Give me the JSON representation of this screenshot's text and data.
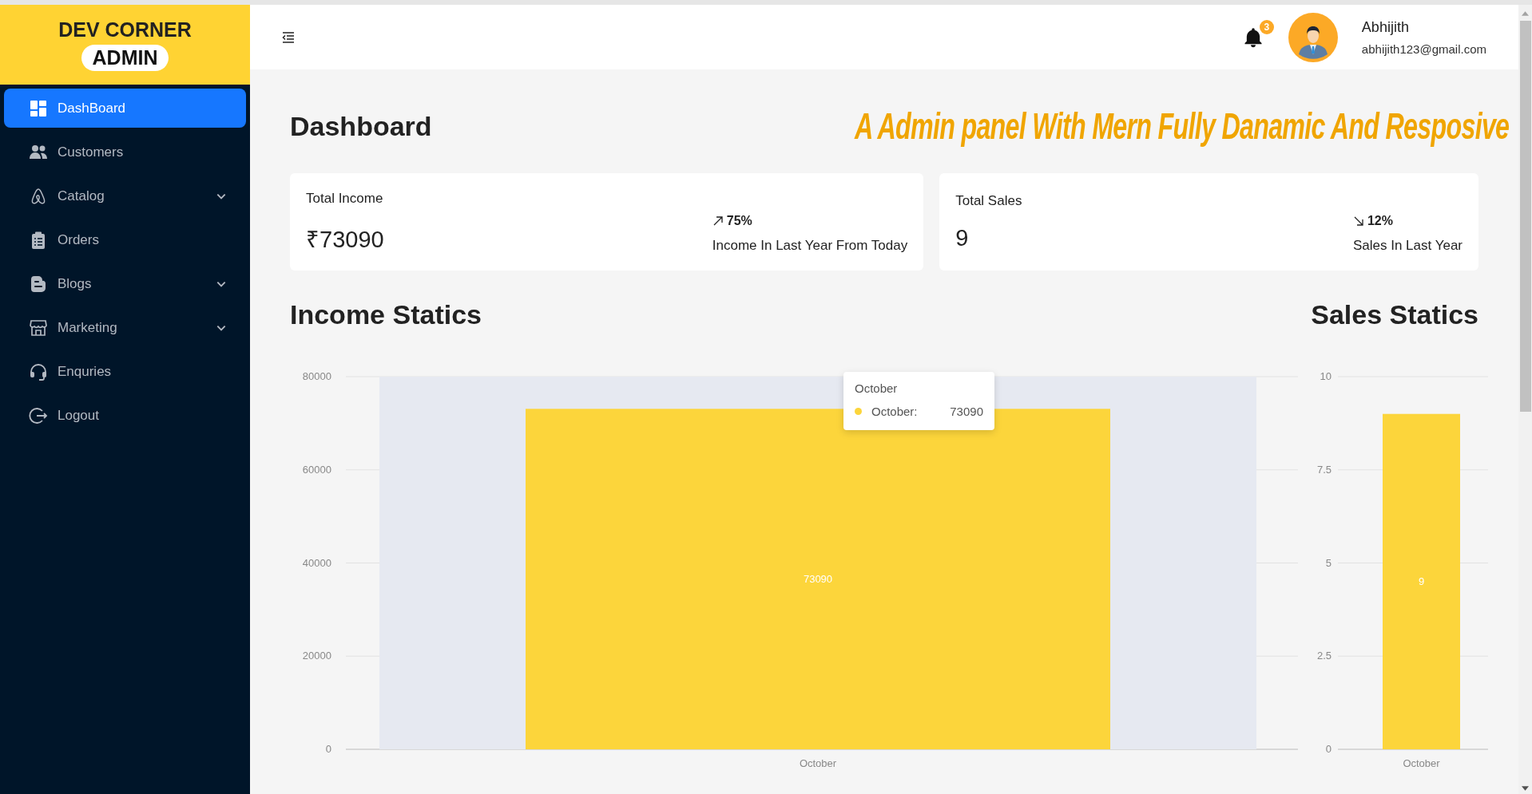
{
  "sidebar": {
    "brand": "DEV CORNER",
    "brand_badge": "ADMIN",
    "items": [
      {
        "label": "DashBoard",
        "kind": "dashboard",
        "selected": true,
        "has_submenu": false
      },
      {
        "label": "Customers",
        "kind": "users",
        "selected": false,
        "has_submenu": false
      },
      {
        "label": "Catalog",
        "kind": "catalog",
        "selected": false,
        "has_submenu": true
      },
      {
        "label": "Orders",
        "kind": "clipboard",
        "selected": false,
        "has_submenu": false
      },
      {
        "label": "Blogs",
        "kind": "blog",
        "selected": false,
        "has_submenu": true
      },
      {
        "label": "Marketing",
        "kind": "shop",
        "selected": false,
        "has_submenu": true
      },
      {
        "label": "Enquries",
        "kind": "headset",
        "selected": false,
        "has_submenu": false
      },
      {
        "label": "Logout",
        "kind": "logout",
        "selected": false,
        "has_submenu": false
      }
    ]
  },
  "header": {
    "notification_count": "3",
    "user": {
      "name": "Abhijith",
      "email": "abhijith123@gmail.com"
    }
  },
  "page": {
    "title": "Dashboard",
    "caption": "A Admin panel With Mern Fully Danamic  And Resposive"
  },
  "stats": [
    {
      "title": "Total Income",
      "value": "₹73090",
      "kind": "up",
      "percent": "75%",
      "note": "Income In Last Year From Today"
    },
    {
      "title": "Total Sales",
      "value": "9",
      "kind": "down",
      "percent": "12%",
      "note": "Sales In Last Year"
    }
  ],
  "charts": [
    {
      "title": "Income Statics",
      "tooltip": {
        "title": "October",
        "label": "October:",
        "value": "73090"
      },
      "highlighted": true,
      "chart_data": {
        "type": "bar",
        "categories": [
          "October"
        ],
        "series": [
          {
            "color": "#fcd53b",
            "values": [
              73090
            ]
          }
        ],
        "ylim": [
          0,
          80000
        ],
        "yticks": [
          0,
          20000,
          40000,
          60000,
          80000
        ],
        "grid": true,
        "value_labels": [
          "73090"
        ]
      }
    },
    {
      "title": "Sales Statics",
      "highlighted": false,
      "chart_data": {
        "type": "bar",
        "categories": [
          "October"
        ],
        "series": [
          {
            "color": "#fcd53b",
            "values": [
              9
            ]
          }
        ],
        "ylim": [
          0,
          10
        ],
        "yticks": [
          0,
          2.5,
          5,
          7.5,
          10
        ],
        "grid": true,
        "value_labels": [
          "9"
        ]
      }
    }
  ]
}
